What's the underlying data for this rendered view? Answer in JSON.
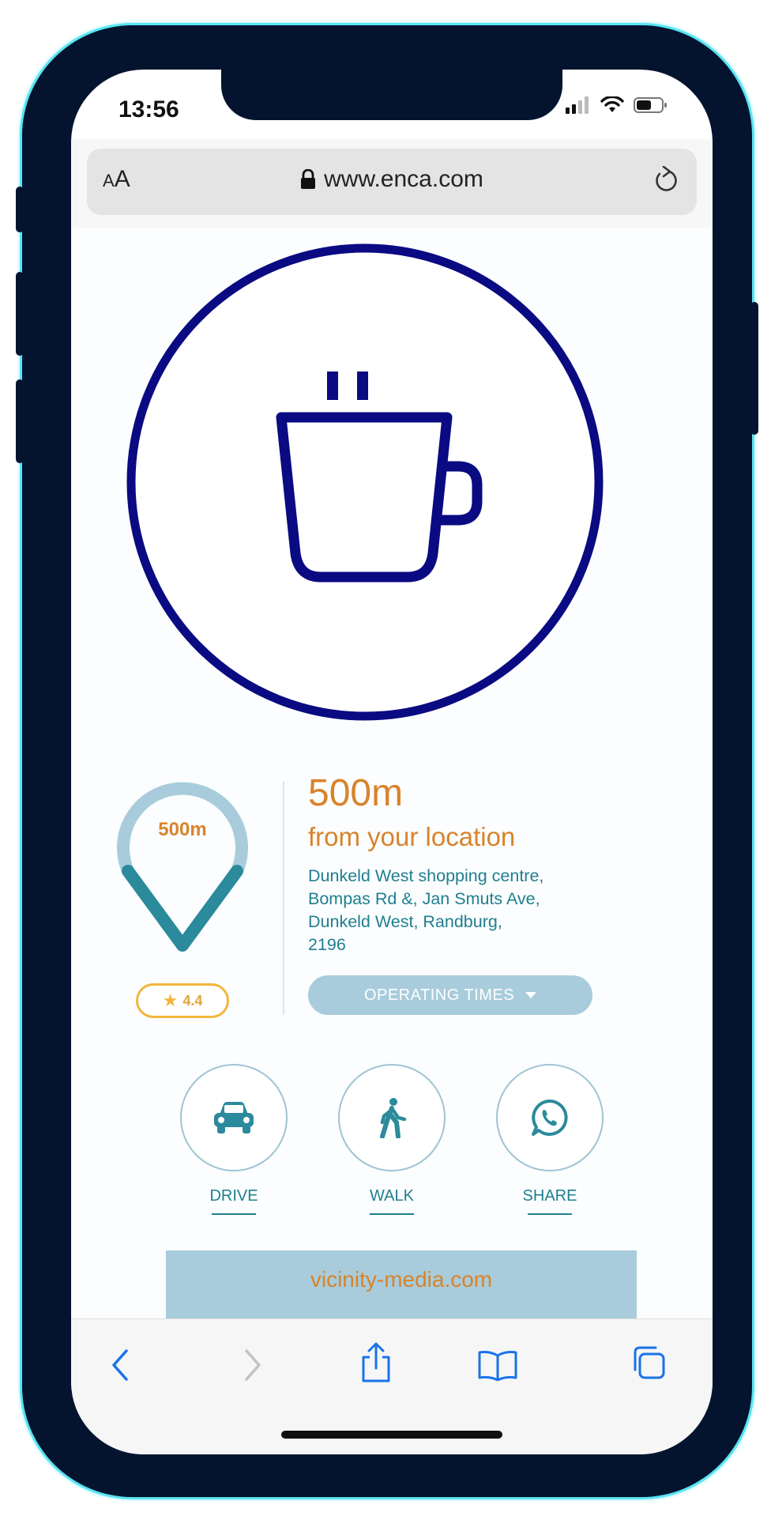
{
  "status_bar": {
    "time": "13:56"
  },
  "browser": {
    "text_size_label_small": "A",
    "text_size_label_large": "A",
    "url": "www.enca.com"
  },
  "location": {
    "pin_distance": "500m",
    "rating": "4.4",
    "distance": "500m",
    "distance_caption": "from your location",
    "address_lines": [
      "Dunkeld West shopping centre,",
      "Bompas Rd &, Jan Smuts Ave,",
      "Dunkeld West, Randburg,",
      "2196"
    ],
    "operating_times_label": "OPERATING TIMES"
  },
  "actions": [
    {
      "label": "DRIVE",
      "icon": "car-icon"
    },
    {
      "label": "WALK",
      "icon": "walking-person-icon"
    },
    {
      "label": "SHARE",
      "icon": "whatsapp-icon"
    }
  ],
  "banner": {
    "text": "vicinity-media.com"
  },
  "colors": {
    "phone_frame": "#04142f",
    "cup_navy": "#0a0a82",
    "accent_orange": "#d9832b",
    "teal": "#1f7f8f",
    "light_blue": "#a8ccdb",
    "ios_blue": "#1a73e8",
    "rating_gold": "#f2b63c"
  }
}
